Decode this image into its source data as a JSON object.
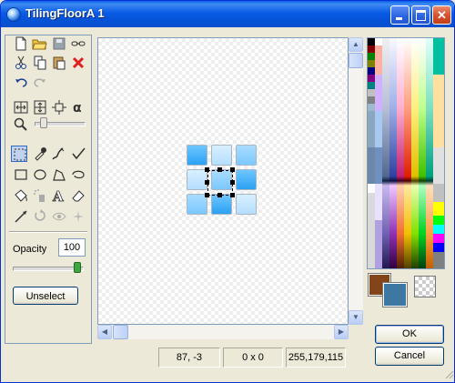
{
  "window": {
    "title": "TilingFloorA 1"
  },
  "tools": {
    "new": "new-file-icon",
    "open": "open-folder-icon",
    "save": "save-disk-icon",
    "link": "link-icon",
    "cut": "scissors-icon",
    "copy": "copy-icon",
    "paste": "paste-icon",
    "delete": "delete-x-icon",
    "undo": "undo-icon",
    "redo": "redo-icon",
    "flip_h": "flip-horizontal-icon",
    "flip_v": "flip-vertical-icon",
    "resize": "resize-icon",
    "alpha": "alpha-icon",
    "zoom": "magnifier-icon",
    "rect_select": "rectangle-select-icon",
    "eyedropper": "eyedropper-icon",
    "pen": "pen-icon",
    "brush": "brush-icon",
    "rectangle": "rectangle-icon",
    "ellipse": "ellipse-icon",
    "polygon": "polygon-icon",
    "lasso": "lasso-icon",
    "fill": "paint-bucket-icon",
    "spray": "spray-icon",
    "text": "text-icon",
    "eraser": "eraser-icon",
    "line": "line-icon",
    "rotate": "rotate-icon",
    "view": "eye-icon",
    "sparkle": "sparkle-icon"
  },
  "opacity": {
    "label": "Opacity",
    "value": "100",
    "level_percent": 100
  },
  "unselect_button": "Unselect",
  "ok_button": "OK",
  "cancel_button": "Cancel",
  "status": {
    "coords": "87, -3",
    "selection_size": "0 x 0",
    "color": "255,179,115"
  },
  "colors": {
    "foreground": "#83441a",
    "background": "#3e78a2",
    "title_bar": "#0a5ce6"
  }
}
